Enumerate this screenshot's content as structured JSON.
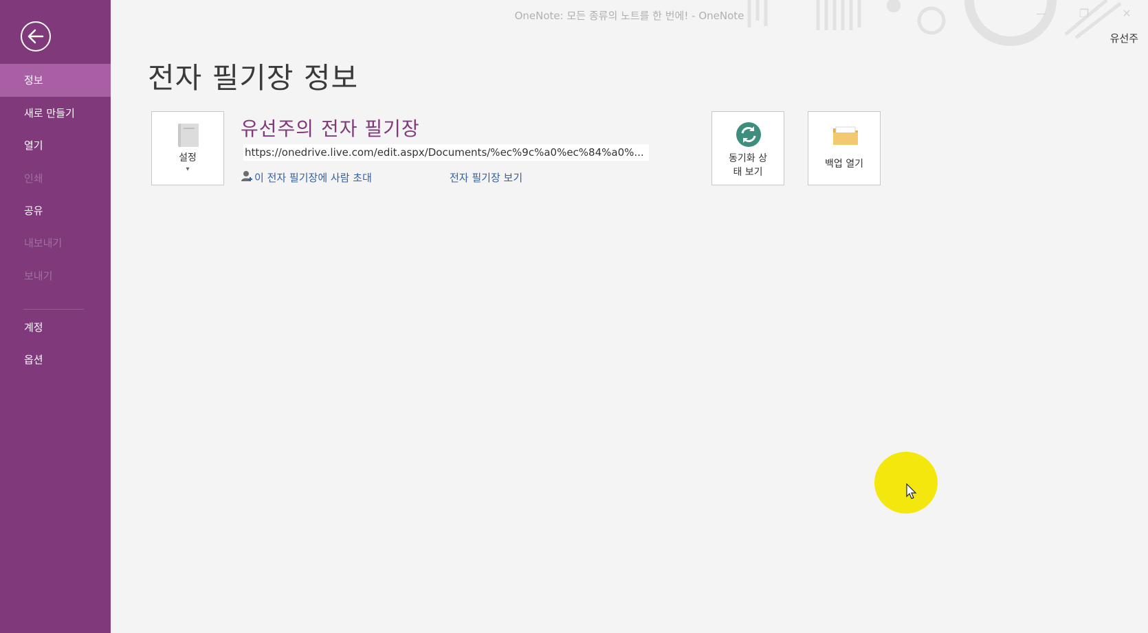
{
  "window": {
    "title": "OneNote: 모든 종류의 노트를 한 번에! - OneNote",
    "user": "유선주",
    "controls": {
      "minimize": "—",
      "restore": "❐",
      "close": "✕"
    }
  },
  "sidebar": {
    "back_label": "뒤로",
    "items": [
      {
        "label": "정보",
        "state": "active"
      },
      {
        "label": "새로 만들기",
        "state": "normal"
      },
      {
        "label": "열기",
        "state": "normal"
      },
      {
        "label": "인쇄",
        "state": "disabled"
      },
      {
        "label": "공유",
        "state": "normal"
      },
      {
        "label": "내보내기",
        "state": "disabled"
      },
      {
        "label": "보내기",
        "state": "disabled"
      },
      {
        "label": "계정",
        "state": "normal"
      },
      {
        "label": "옵션",
        "state": "normal"
      }
    ]
  },
  "main": {
    "page_title": "전자 필기장 정보",
    "notebook": {
      "settings_label": "설정",
      "settings_caret": "▾",
      "name": "유선주의 전자 필기장",
      "url": "https://onedrive.live.com/edit.aspx/Documents/%ec%9c%a0%ec%84%a0%...",
      "invite_link": "이 전자 필기장에 사람 초대",
      "view_link": "전자 필기장 보기"
    },
    "actions": {
      "sync_line1": "동기화 상",
      "sync_line2": "태 보기",
      "backup_label": "백업 열기"
    }
  },
  "colors": {
    "sidebar_bg": "#80397b",
    "sidebar_active": "#a95fa4",
    "accent": "#80397b",
    "link": "#2f5fa7",
    "sync_icon": "#3e8e7e",
    "folder_icon": "#f0c46a"
  },
  "icons": [
    "back-arrow-icon",
    "notebook-icon",
    "sync-icon",
    "folder-icon",
    "add-person-icon",
    "mouse-cursor-icon"
  ]
}
